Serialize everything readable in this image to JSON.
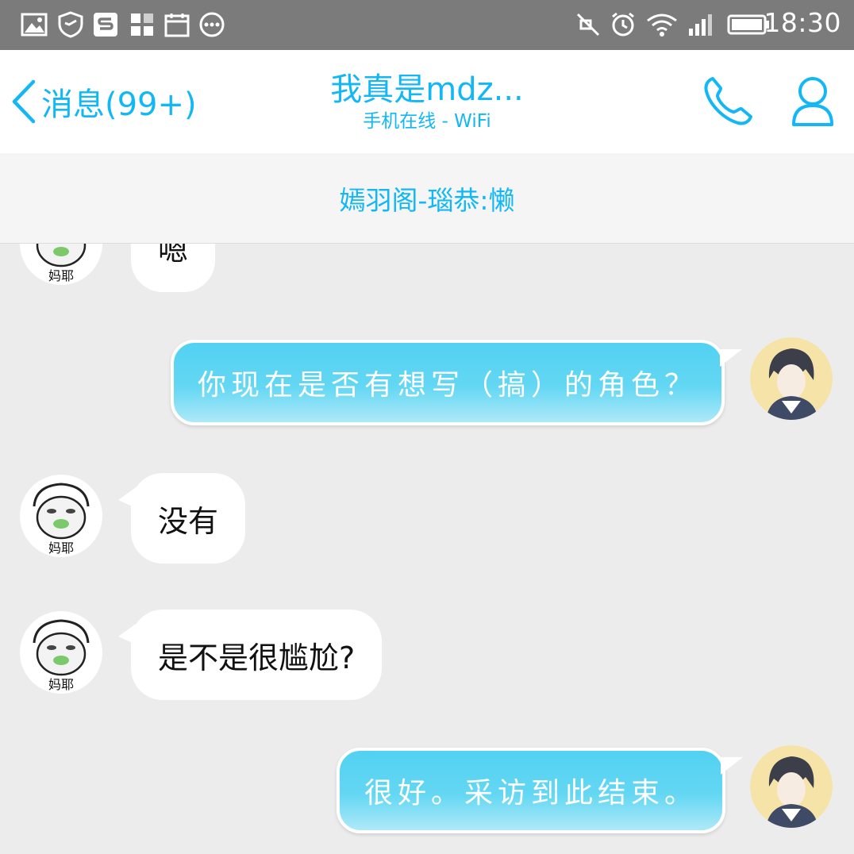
{
  "status_bar": {
    "time": "18:30",
    "left_icons": [
      "image-icon",
      "shield-icon",
      "s-app-icon",
      "grid-app-icon",
      "calendar-icon",
      "more-dots-icon"
    ],
    "right_icons": [
      "mute-icon",
      "alarm-icon",
      "wifi-icon",
      "signal-icon",
      "battery-icon"
    ]
  },
  "header": {
    "back_label": "消息(99+)",
    "title": "我真是mdz...",
    "subtitle": "手机在线 - WiFi"
  },
  "banner": {
    "text": "嫣羽阁-瑙恭:懒"
  },
  "messages": [
    {
      "side": "left",
      "text": "嗯",
      "avatar_label": "妈耶"
    },
    {
      "side": "right",
      "text": "你现在是否有想写（搞）的角色？"
    },
    {
      "side": "left",
      "text": "没有",
      "avatar_label": "妈耶"
    },
    {
      "side": "left",
      "text": "是不是很尴尬?",
      "avatar_label": "妈耶"
    },
    {
      "side": "right",
      "text": "很好。采访到此结束。"
    }
  ],
  "colors": {
    "accent": "#12b7f5",
    "status_bar": "#7b7b7b",
    "chat_bg": "#ececec",
    "bubble_right": "#52d1f2"
  }
}
